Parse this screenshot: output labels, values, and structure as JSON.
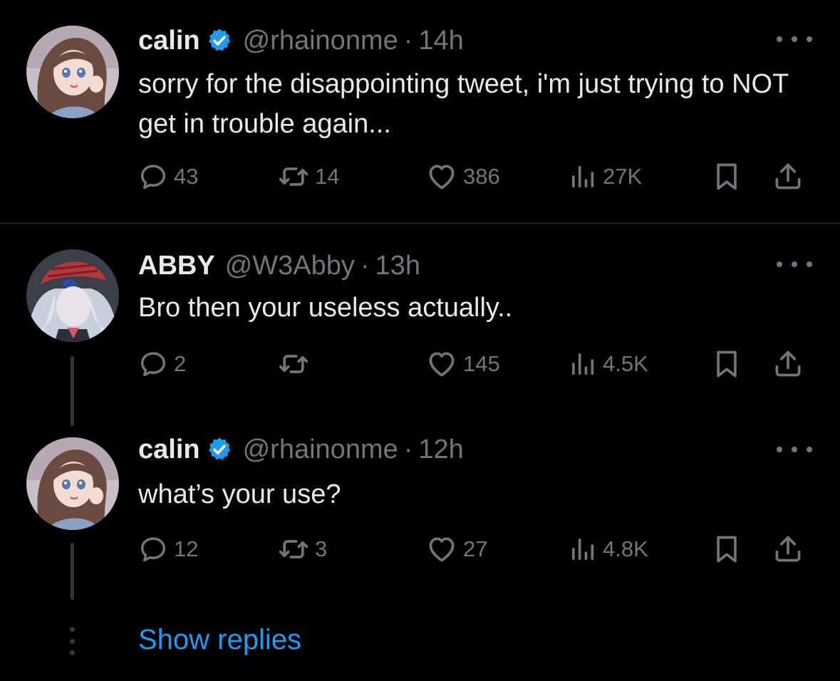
{
  "colors": {
    "background": "#000000",
    "text": "#e7e9ea",
    "muted": "#71767b",
    "verified": "#1d9bf0",
    "link": "#1d9bf0",
    "divider": "#2f3336"
  },
  "tweets": [
    {
      "name": "calin",
      "verified": true,
      "handle": "@rhainonme",
      "time": "14h",
      "text": "sorry for the disappointing tweet, i'm just trying to NOT get in trouble again...",
      "replies": "43",
      "retweets": "14",
      "likes": "386",
      "views": "27K"
    },
    {
      "name": "ABBY",
      "verified": false,
      "handle": "@W3Abby",
      "time": "13h",
      "text": "Bro then your useless actually..",
      "replies": "2",
      "retweets": "",
      "likes": "145",
      "views": "4.5K"
    },
    {
      "name": "calin",
      "verified": true,
      "handle": "@rhainonme",
      "time": "12h",
      "text": "what’s your use?",
      "replies": "12",
      "retweets": "3",
      "likes": "27",
      "views": "4.8K"
    }
  ],
  "separator": "·",
  "show_replies_label": "Show replies",
  "icons": {
    "reply": "speech-bubble-icon",
    "retweet": "retweet-arrows-icon",
    "like": "heart-icon",
    "views": "bar-chart-icon",
    "bookmark": "bookmark-icon",
    "share": "share-upload-icon",
    "more": "ellipsis-icon",
    "verified": "verified-badge-icon"
  }
}
